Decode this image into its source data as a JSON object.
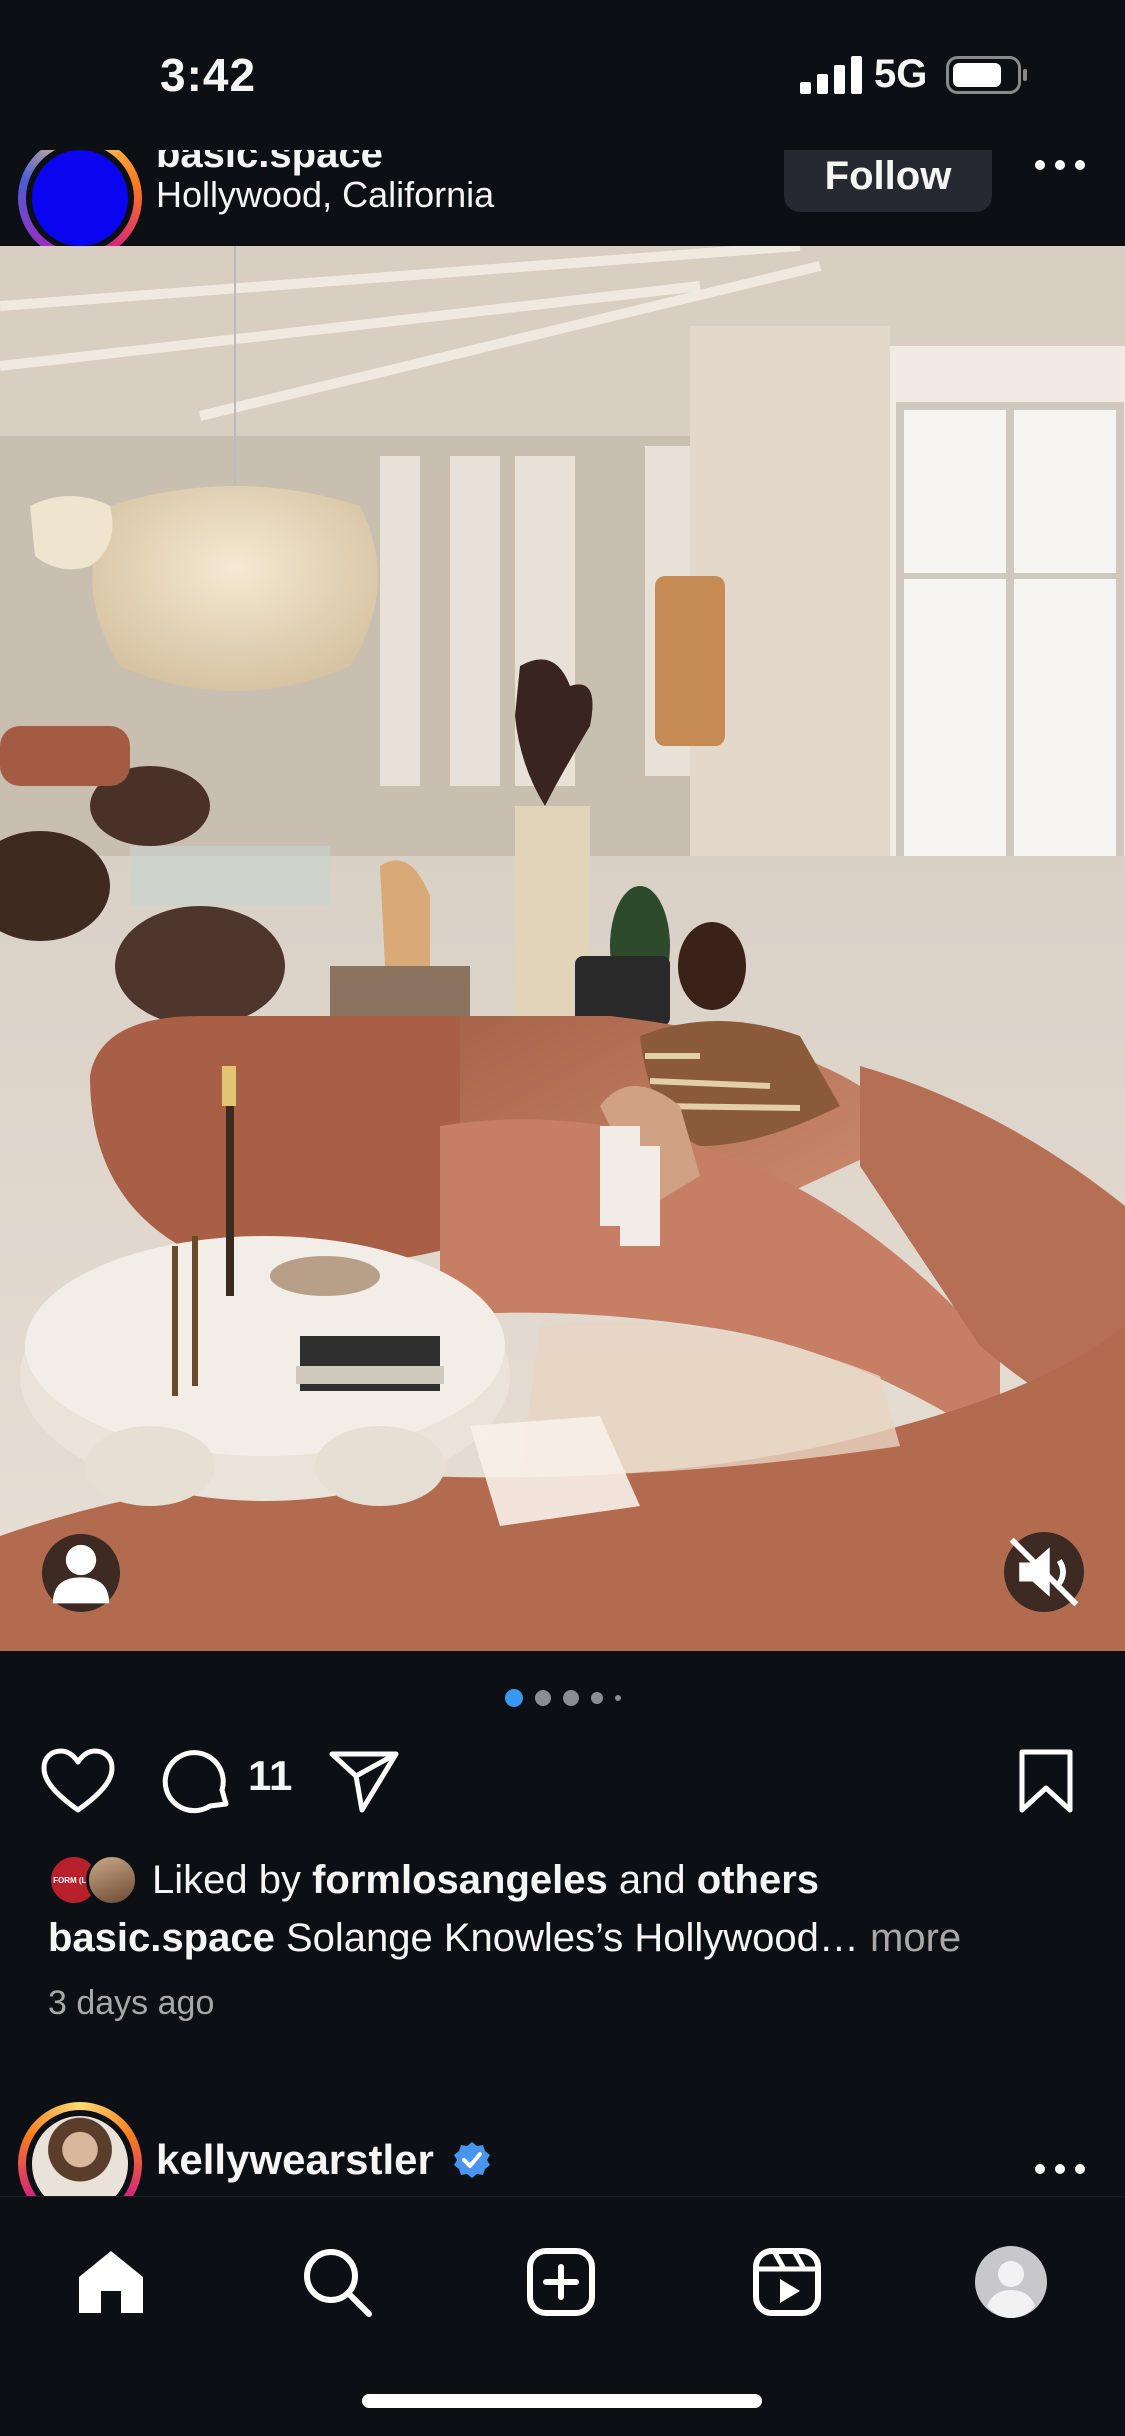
{
  "status_bar": {
    "time": "3:42",
    "network": "5G"
  },
  "post": {
    "username": "basic.space",
    "location": "Hollywood, California",
    "follow_label": "Follow",
    "comment_count": "11",
    "carousel": {
      "total": 5,
      "active": 1
    },
    "likes": {
      "prefix": "Liked by",
      "user": "formlosangeles",
      "joiner": "and",
      "others": "others",
      "avatar_label": "FORM (LA)"
    },
    "caption": {
      "user": "basic.space",
      "text": "Solange Knowles’s Hollywood…",
      "more": "more"
    },
    "time_ago": "3 days ago"
  },
  "next_post": {
    "username": "kellywearstler",
    "verified": true
  },
  "tab_bar": {
    "items": [
      "home-icon",
      "search-icon",
      "create-icon",
      "reels-icon",
      "profile-icon"
    ],
    "active": "home-icon"
  },
  "colors": {
    "background": "#0c1014",
    "text": "#f5f5f5",
    "muted": "#a8a8a8",
    "active_dot": "#3897f0",
    "verified": "#4a94f0"
  }
}
